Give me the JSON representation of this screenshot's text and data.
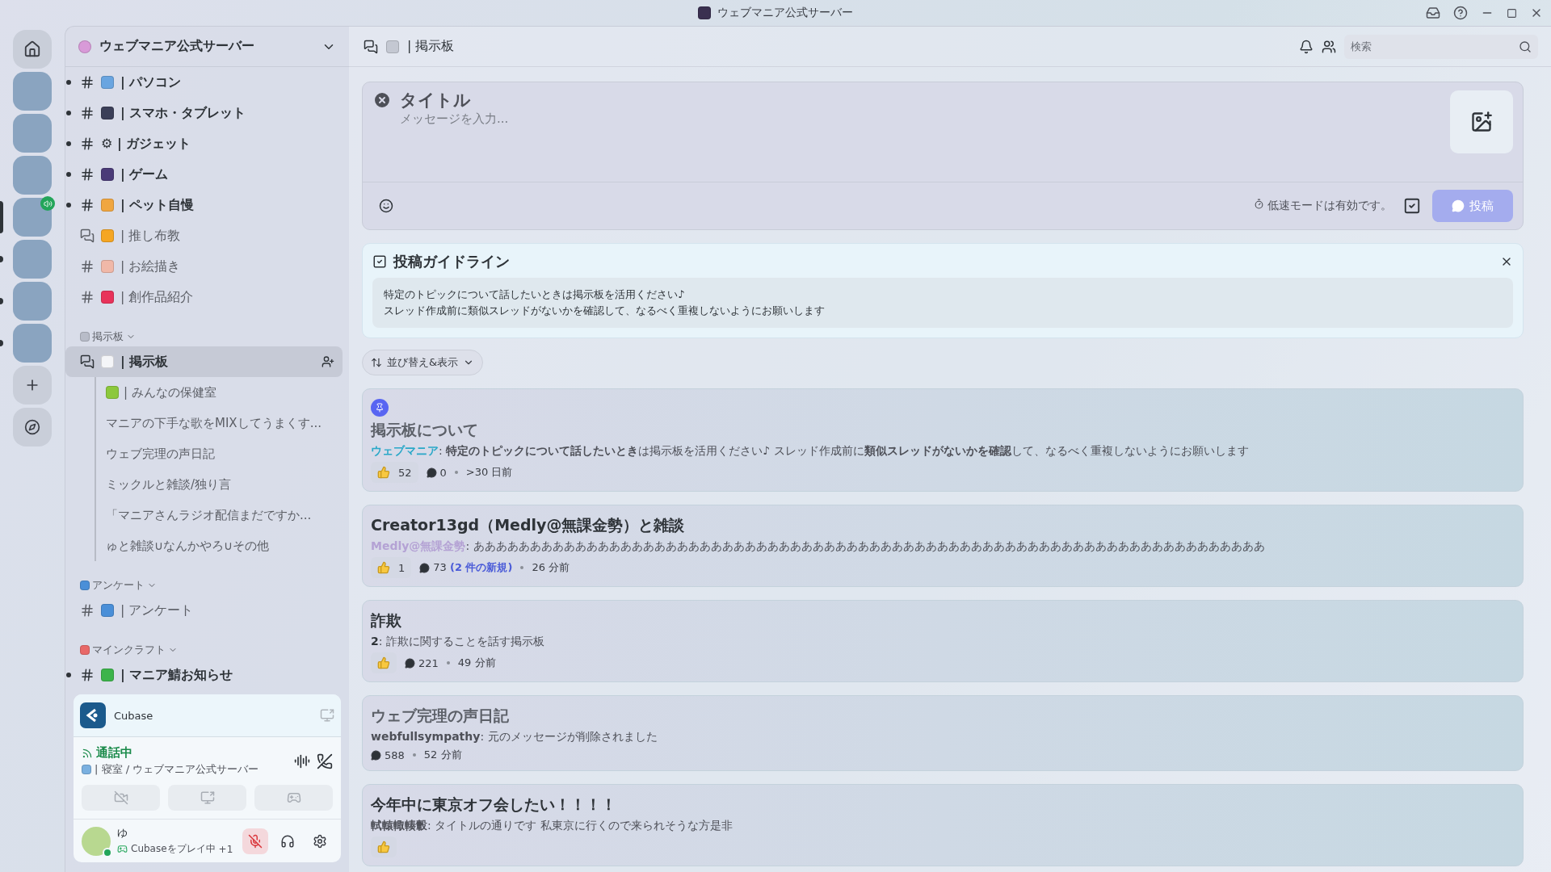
{
  "window": {
    "title": "ウェブマニア公式サーバー"
  },
  "server_rail": [
    {
      "kind": "home",
      "selected": false,
      "unread": false,
      "voice": false
    },
    {
      "kind": "server",
      "selected": false,
      "unread": false,
      "voice": false
    },
    {
      "kind": "server",
      "selected": false,
      "unread": false,
      "voice": false
    },
    {
      "kind": "server",
      "selected": false,
      "unread": false,
      "voice": false
    },
    {
      "kind": "server",
      "selected": true,
      "unread": false,
      "voice": true
    },
    {
      "kind": "server",
      "selected": false,
      "unread": true,
      "voice": false
    },
    {
      "kind": "server",
      "selected": false,
      "unread": true,
      "voice": false
    },
    {
      "kind": "server",
      "selected": false,
      "unread": true,
      "voice": false
    },
    {
      "kind": "add",
      "selected": false,
      "unread": false,
      "voice": false
    },
    {
      "kind": "explore",
      "selected": false,
      "unread": false,
      "voice": false
    }
  ],
  "sidebar": {
    "server_name": "ウェブマニア公式サーバー",
    "channels": [
      {
        "kind": "text",
        "label": "| パソコン",
        "unread": true,
        "selected": false,
        "color": "#6aa5e0"
      },
      {
        "kind": "text",
        "label": "| スマホ・タブレット",
        "unread": true,
        "selected": false,
        "color": "#3b3f58"
      },
      {
        "kind": "text",
        "label": "⚙ | ガジェット",
        "unread": true,
        "selected": false
      },
      {
        "kind": "text",
        "label": "| ゲーム",
        "unread": true,
        "selected": false,
        "color": "#4b3b78"
      },
      {
        "kind": "text",
        "label": "| ペット自慢",
        "unread": true,
        "selected": false,
        "color": "#f0a640"
      },
      {
        "kind": "forum",
        "label": "| 推し布教",
        "unread": false,
        "selected": false,
        "color": "#f5a623"
      },
      {
        "kind": "text",
        "label": "| お絵描き",
        "unread": false,
        "selected": false,
        "color": "#f0b8a8"
      },
      {
        "kind": "text",
        "label": "| 創作品紹介",
        "unread": false,
        "selected": false,
        "color": "#e8325a"
      }
    ],
    "categories": [
      {
        "name": "掲示板",
        "color": "#b8bcc8",
        "channels": [
          {
            "kind": "forum",
            "label": "| 掲示板",
            "unread": false,
            "selected": true,
            "color": "#f4f5f8",
            "children": [
              {
                "label": "| みんなの保健室",
                "color": "#8cc83c"
              },
              {
                "label": "マニアの下手な歌をMIXしてうまくす..."
              },
              {
                "label": "ウェブ完理の声日記"
              },
              {
                "label": "ミックルと雑談/独り言"
              },
              {
                "label": "「マニアさんラジオ配信まだですか..."
              },
              {
                "label": "ゅと雑談∪なんかやろ∪その他"
              }
            ]
          }
        ]
      },
      {
        "name": "アンケート",
        "color": "#4a8fd8",
        "channels": [
          {
            "kind": "text",
            "label": "| アンケート",
            "unread": false,
            "selected": false,
            "color": "#4a8fd8"
          }
        ]
      },
      {
        "name": "マインクラフト",
        "color": "#e86868",
        "channels": [
          {
            "kind": "text",
            "label": "| マニア鯖お知らせ",
            "unread": true,
            "selected": false,
            "color": "#3cb44a"
          }
        ]
      }
    ]
  },
  "voice_panel": {
    "activity": "Cubase",
    "status": "通話中",
    "channel": "| 寝室 / ウェブマニア公式サーバー",
    "user": "ゆ",
    "user_status": "Cubaseをプレイ中",
    "extra": "+1",
    "muted": true
  },
  "header": {
    "channel": "| 掲示板",
    "search": {
      "placeholder": "検索"
    }
  },
  "composer": {
    "title": {
      "placeholder": "タイトル"
    },
    "message": {
      "placeholder": "メッセージを入力..."
    },
    "slowmode": "低速モードは有効です。",
    "post_button": {
      "label": "投稿",
      "disabled": true
    }
  },
  "guidelines": {
    "title": "投稿ガイドライン",
    "lines": [
      "特定のトピックについて話したいときは掲示板を活用ください♪",
      "スレッド作成前に類似スレッドがないかを確認して、なるべく重複しないようにお願いします"
    ]
  },
  "sort_button": "並び替え&表示",
  "posts": [
    {
      "pinned": true,
      "read": true,
      "title": "掲示板について",
      "author": "ウェブマニア",
      "color": "#2aa8c8",
      "preview": ": **特定のトピックについて話したいとき**は掲示板を活用ください♪ スレッド作成前に**類似スレッドがないかを確認**して、なるべく重複しないようにお願いします",
      "reaction": true,
      "reaction_count": "52",
      "replies": "0",
      "time": ">30 日前"
    },
    {
      "pinned": false,
      "read": false,
      "title": "Creator13gd（Medly@無課金勢）と雑談",
      "author": "Medly@無課金勢",
      "color": "#b4a2d4",
      "preview": ": ああああああああああああああああああああああああああああああああああああああああああああああああああああああああああああああああああああああ",
      "reaction": true,
      "reaction_count": "1",
      "replies": "73",
      "new": "(2 件の新規)",
      "time": "26 分前"
    },
    {
      "pinned": false,
      "read": false,
      "title": "詐欺",
      "author": "2",
      "color": "#2e3338",
      "preview": ": 詐欺に関することを話す掲示板",
      "reaction": true,
      "replies": "221",
      "time": "49 分前"
    },
    {
      "pinned": false,
      "read": true,
      "title": "ウェブ完理の声日記",
      "author": "webfullsympathy",
      "color": "#4e5058",
      "preview": ": 元のメッセージが削除されました",
      "reaction": false,
      "replies": "588",
      "time": "52 分前"
    },
    {
      "pinned": false,
      "read": false,
      "title": "今年中に東京オフ会したい！！！！",
      "author": "軾轅輙輳轂",
      "color": "#4e5058",
      "preview": ": タイトルの通りです 私東京に行くので来られそうな方是非",
      "reaction": true
    }
  ]
}
